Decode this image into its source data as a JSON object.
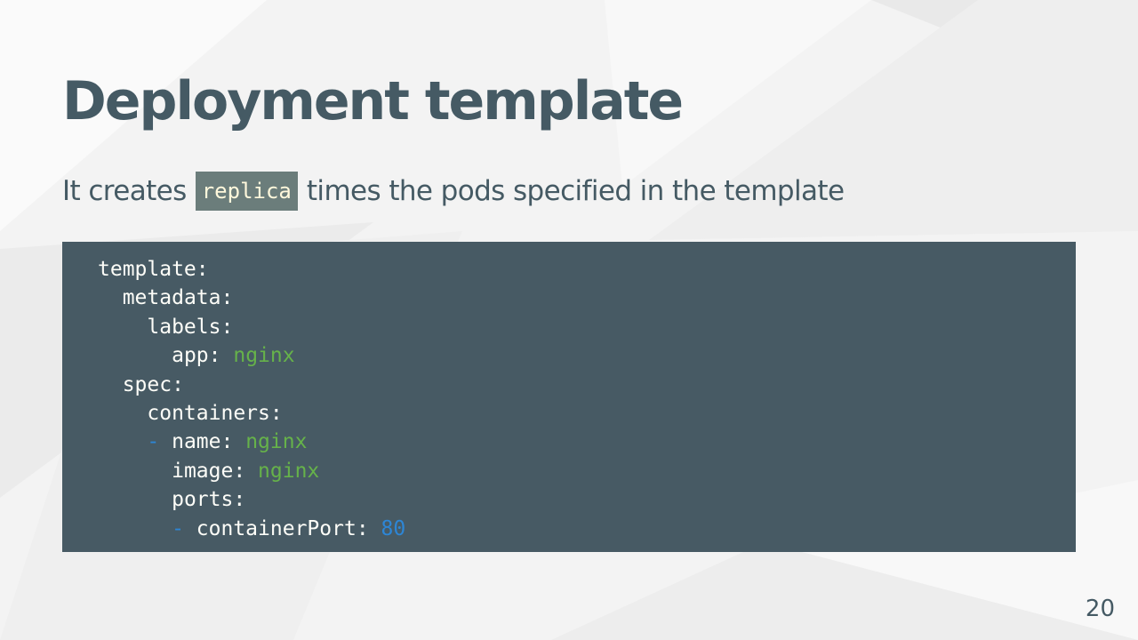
{
  "slide": {
    "title": "Deployment template",
    "subtitle": {
      "before": "It creates",
      "code": "replica",
      "after": "times the pods specified in the template"
    },
    "code_lines": [
      {
        "indent": 0,
        "dash": "",
        "key": "template",
        "sep": ":",
        "value": "",
        "value_type": ""
      },
      {
        "indent": 1,
        "dash": "",
        "key": "metadata",
        "sep": ":",
        "value": "",
        "value_type": ""
      },
      {
        "indent": 2,
        "dash": "",
        "key": "labels",
        "sep": ":",
        "value": "",
        "value_type": ""
      },
      {
        "indent": 3,
        "dash": "",
        "key": "app",
        "sep": ": ",
        "value": "nginx",
        "value_type": "string"
      },
      {
        "indent": 1,
        "dash": "",
        "key": "spec",
        "sep": ":",
        "value": "",
        "value_type": ""
      },
      {
        "indent": 2,
        "dash": "",
        "key": "containers",
        "sep": ":",
        "value": "",
        "value_type": ""
      },
      {
        "indent": 2,
        "dash": "- ",
        "key": "name",
        "sep": ": ",
        "value": "nginx",
        "value_type": "string"
      },
      {
        "indent": 3,
        "dash": "",
        "key": "image",
        "sep": ": ",
        "value": "nginx",
        "value_type": "string"
      },
      {
        "indent": 3,
        "dash": "",
        "key": "ports",
        "sep": ":",
        "value": "",
        "value_type": ""
      },
      {
        "indent": 3,
        "dash": "- ",
        "key": "containerPort",
        "sep": ": ",
        "value": "80",
        "value_type": "number"
      }
    ],
    "page_number": "20"
  },
  "colors": {
    "heading": "#455a64",
    "code_background": "#475a64",
    "inline_code_background": "#6b7d7b",
    "code_string": "#66b24a",
    "code_number": "#2d86d6"
  }
}
